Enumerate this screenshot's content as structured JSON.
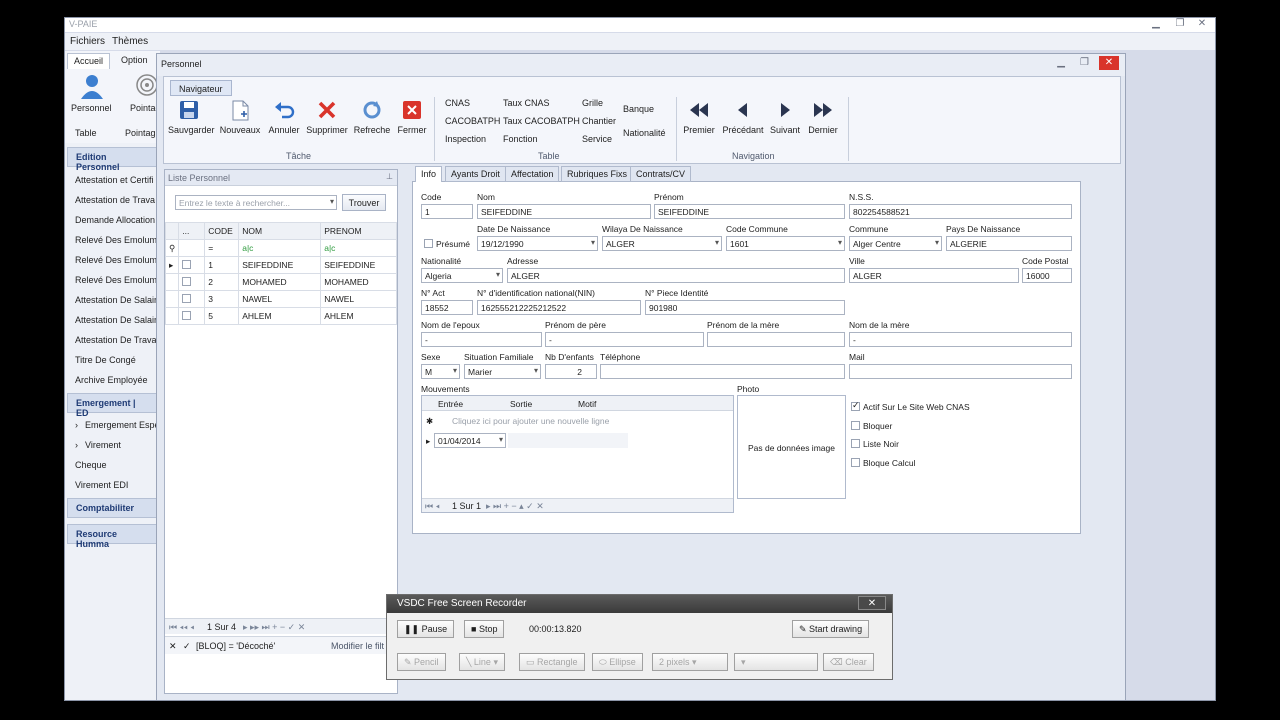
{
  "app": {
    "title": "V-PAIE",
    "menu": [
      "Fichiers",
      "Thèmes"
    ],
    "tabs": [
      "Accueil",
      "Option"
    ],
    "ribbon_small": {
      "personnel": "Personnel",
      "pointage": "Pointag",
      "table": "Table",
      "pointage2": "Pointag"
    }
  },
  "sidebar": {
    "groups": [
      "Edition Personnel",
      "Emergement | ED",
      "Comptabiliter",
      "Resource Humma"
    ],
    "edition_items": [
      "Attestation et Certifi",
      "Attestation de Trava",
      "Demande Allocation F",
      "Relevé Des Emolume",
      "Relevé Des Emolume",
      "Relevé Des Emolume",
      "Attestation De Salair",
      "Attestation De Salair",
      "Attestation De Trava",
      "Titre De Congé",
      "Archive Employée"
    ],
    "emergement_items": [
      "Emergement Espè",
      "Virement",
      "Cheque",
      "Virement EDI"
    ]
  },
  "window": {
    "title": "Personnel"
  },
  "ribbon": {
    "tab": "Navigateur",
    "tache": {
      "label": "Tâche",
      "buttons": [
        "Sauvgarder",
        "Nouveaux",
        "Annuler",
        "Supprimer",
        "Refreche",
        "Fermer"
      ]
    },
    "table": {
      "label": "Table",
      "links": [
        "CNAS",
        "Taux CNAS",
        "Grille",
        "Banque",
        "CACOBATPH",
        "Taux CACOBATPH",
        "Chantier",
        "Nationalité",
        "Inspection",
        "Fonction",
        "Service"
      ]
    },
    "navigation": {
      "label": "Navigation",
      "buttons": [
        "Premier",
        "Précédant",
        "Suivant",
        "Dernier"
      ]
    }
  },
  "list": {
    "title": "Liste Personnel",
    "search_placeholder": "Entrez le texte à rechercher...",
    "find_label": "Trouver",
    "headers": [
      "...",
      "CODE",
      "NOM",
      "PRENOM"
    ],
    "filter_icons": [
      "=",
      "a|c",
      "a|c"
    ],
    "rows": [
      {
        "code": "1",
        "nom": "SEIFEDDINE",
        "prenom": "SEIFEDDINE"
      },
      {
        "code": "2",
        "nom": "MOHAMED",
        "prenom": "MOHAMED"
      },
      {
        "code": "3",
        "nom": "NAWEL",
        "prenom": "NAWEL"
      },
      {
        "code": "5",
        "nom": "AHLEM",
        "prenom": "AHLEM"
      }
    ],
    "pager": "1 Sur 4",
    "filter_text": "[BLOQ] = 'Décoché'",
    "modify_filter": "Modifier le filt"
  },
  "detail": {
    "tabs": [
      "Info",
      "Ayants Droit",
      "Affectation",
      "Rubriques Fixs",
      "Contrats/CV"
    ],
    "labels": {
      "code": "Code",
      "nom": "Nom",
      "prenom": "Prénom",
      "nss": "N.S.S.",
      "presume": "Présumé",
      "date_naissance": "Date De Naissance",
      "wilaya": "Wilaya De Naissance",
      "code_commune": "Code Commune",
      "commune": "Commune",
      "pays": "Pays De Naissance",
      "nationalite": "Nationalité",
      "adresse": "Adresse",
      "ville": "Ville",
      "code_postal": "Code Postal",
      "n_act": "N° Act",
      "nin": "N° d'identification national(NIN)",
      "piece": "N° Piece Identité",
      "epoux": "Nom de l'epoux",
      "prenom_pere": "Prénom de père",
      "prenom_mere": "Prénom de la mère",
      "nom_mere": "Nom de la mère",
      "sexe": "Sexe",
      "situation": "Situation Familiale",
      "nb_enfants": "Nb D'enfants",
      "telephone": "Téléphone",
      "mail": "Mail",
      "mouvements": "Mouvements",
      "photo": "Photo"
    },
    "values": {
      "code": "1",
      "nom": "SEIFEDDINE",
      "prenom": "SEIFEDDINE",
      "nss": "802254588521",
      "date_naissance": "19/12/1990",
      "wilaya": "ALGER",
      "code_commune": "1601",
      "commune": "Alger Centre",
      "pays": "ALGERIE",
      "nationalite": "Algeria",
      "adresse": "ALGER",
      "ville": "ALGER",
      "code_postal": "16000",
      "n_act": "18552",
      "nin": "162555212225212522",
      "piece": "901980",
      "epoux": "-",
      "prenom_pere": "-",
      "nom_mere": "-",
      "sexe": "M",
      "situation": "Marier",
      "nb_enfants": "2"
    },
    "mouvements": {
      "headers": [
        "Entrée",
        "Sortie",
        "Motif"
      ],
      "new_row_hint": "Cliquez ici pour ajouter une nouvelle ligne",
      "row_date": "01/04/2014",
      "pager": "1 Sur 1"
    },
    "photo_text": "Pas de données image",
    "checks": [
      {
        "label": "Actif Sur Le Site Web CNAS",
        "checked": true
      },
      {
        "label": "Bloquer",
        "checked": false
      },
      {
        "label": "Liste Noir",
        "checked": false
      },
      {
        "label": "Bloque Calcul",
        "checked": false
      }
    ]
  },
  "recorder": {
    "title": "VSDC Free Screen Recorder",
    "pause": "Pause",
    "stop": "Stop",
    "time": "00:00:13.820",
    "start_drawing": "Start drawing",
    "tools": [
      "Pencil",
      "Line",
      "Rectangle",
      "Ellipse",
      "2 pixels",
      "Clear"
    ]
  },
  "colors": {
    "accent_red": "#d9342b",
    "nav_blue": "#1f3b75",
    "recorder_title": "#3a3a3a"
  }
}
